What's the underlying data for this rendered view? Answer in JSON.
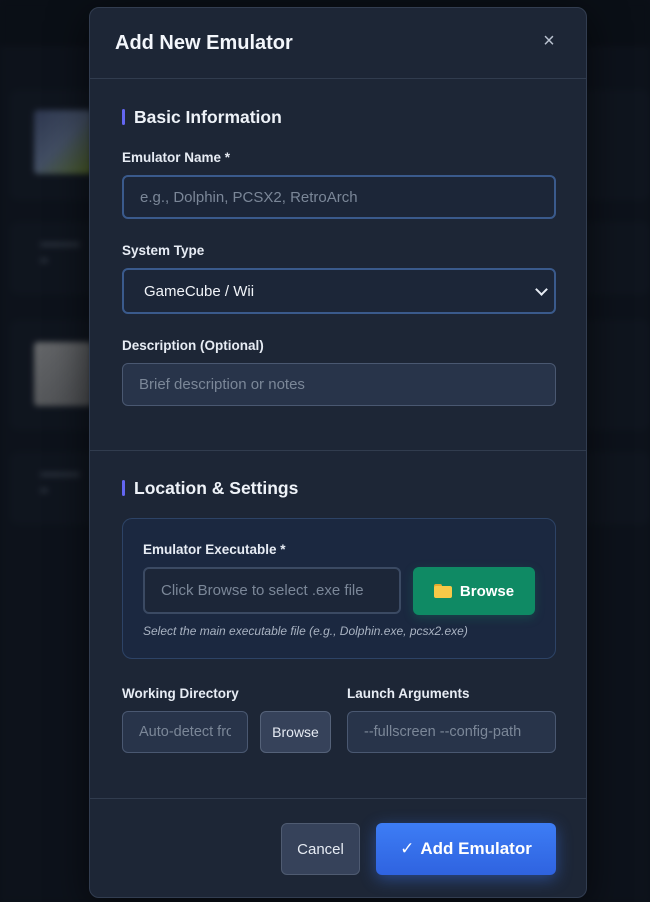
{
  "modal": {
    "title": "Add New Emulator",
    "close_label": "×"
  },
  "basic_section": {
    "title": "Basic Information",
    "name_label": "Emulator Name *",
    "name_placeholder": "e.g., Dolphin, PCSX2, RetroArch",
    "name_value": "",
    "system_label": "System Type",
    "system_value": "GameCube / Wii",
    "description_label": "Description (Optional)",
    "description_placeholder": "Brief description or notes",
    "description_value": ""
  },
  "location_section": {
    "title": "Location & Settings",
    "exe_label": "Emulator Executable *",
    "exe_placeholder": "Click Browse to select .exe file",
    "exe_value": "",
    "browse_label": "Browse",
    "browse_icon": "folder-icon",
    "exe_hint": "Select the main executable file (e.g., Dolphin.exe, pcsx2.exe)",
    "workdir_label": "Working Directory",
    "workdir_placeholder": "Auto-detect from exe",
    "workdir_value": "",
    "workdir_browse_label": "Browse",
    "args_label": "Launch Arguments",
    "args_placeholder": "--fullscreen --config-path",
    "args_value": ""
  },
  "footer": {
    "cancel_label": "Cancel",
    "add_label": "Add Emulator",
    "add_icon": "✓"
  },
  "colors": {
    "accent": "#6366f1",
    "primary_button": "#3d7df5",
    "browse_button": "#0f8a64",
    "modal_bg": "#1d2636"
  }
}
